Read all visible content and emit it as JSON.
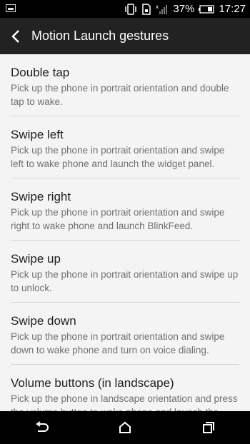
{
  "status": {
    "battery_percent": "37%",
    "time": "17:27"
  },
  "toolbar": {
    "title": "Motion Launch gestures"
  },
  "items": [
    {
      "title": "Double tap",
      "desc": "Pick up the phone in portrait orientation and double tap to wake."
    },
    {
      "title": "Swipe left",
      "desc": "Pick up the phone in portrait orientation and swipe left to wake phone and launch the widget panel."
    },
    {
      "title": "Swipe right",
      "desc": "Pick up the phone in portrait orientation and swipe right to wake phone and launch BlinkFeed."
    },
    {
      "title": "Swipe up",
      "desc": "Pick up the phone in portrait orientation and swipe up to unlock."
    },
    {
      "title": "Swipe down",
      "desc": "Pick up the phone in portrait orientation and swipe down to wake phone and turn on voice dialing."
    },
    {
      "title": "Volume buttons (in landscape)",
      "desc": "Pick up the phone in landscape orientation and press the volume button to wake phone and launch the camera app."
    }
  ],
  "icons": {
    "notification": "image-icon",
    "vibrate": "vibrate-icon",
    "sim": "sim-card-icon",
    "signal": "signal-icon",
    "battery": "battery-icon",
    "back": "back-arrow-icon",
    "nav_back": "nav-back-icon",
    "nav_home": "nav-home-icon",
    "nav_recents": "nav-recents-icon"
  }
}
